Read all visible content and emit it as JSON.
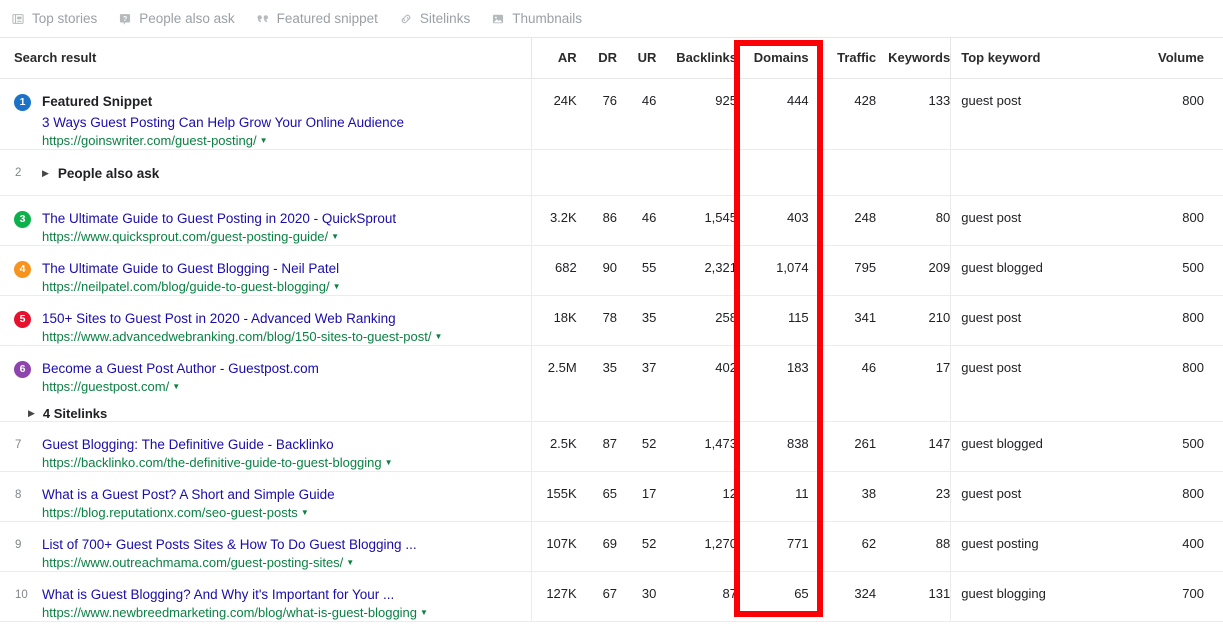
{
  "feature_bar": {
    "chips": [
      {
        "label": "Top stories",
        "icon": "news-article-icon"
      },
      {
        "label": "People also ask",
        "icon": "question-box-icon"
      },
      {
        "label": "Featured snippet",
        "icon": "quotation-marks-icon"
      },
      {
        "label": "Sitelinks",
        "icon": "link-chain-icon"
      },
      {
        "label": "Thumbnails",
        "icon": "image-thumbnail-icon"
      }
    ]
  },
  "table": {
    "headers": {
      "search_result": "Search result",
      "ar": "AR",
      "dr": "DR",
      "ur": "UR",
      "backlinks": "Backlinks",
      "domains": "Domains",
      "traffic": "Traffic",
      "keywords": "Keywords",
      "top_keyword": "Top keyword",
      "volume": "Volume"
    },
    "rows": [
      {
        "kind": "result",
        "rank": "1",
        "badge_color": "#1a73c8",
        "label": "Featured Snippet",
        "title": "3 Ways Guest Posting Can Help Grow Your Online Audience",
        "url": "https://goinswriter.com/guest-posting/",
        "ar": "24K",
        "dr": "76",
        "ur": "46",
        "backlinks": "925",
        "domains": "444",
        "traffic": "428",
        "keywords": "133",
        "top_keyword": "guest post",
        "volume": "800"
      },
      {
        "kind": "paa",
        "rank": "2",
        "label": "People also ask"
      },
      {
        "kind": "result",
        "rank": "3",
        "badge_color": "#0db14b",
        "title": "The Ultimate Guide to Guest Posting in 2020 - QuickSprout",
        "url": "https://www.quicksprout.com/guest-posting-guide/",
        "ar": "3.2K",
        "dr": "86",
        "ur": "46",
        "backlinks": "1,545",
        "domains": "403",
        "traffic": "248",
        "keywords": "80",
        "top_keyword": "guest post",
        "volume": "800"
      },
      {
        "kind": "result",
        "rank": "4",
        "badge_color": "#f7941e",
        "title": "The Ultimate Guide to Guest Blogging - Neil Patel",
        "url": "https://neilpatel.com/blog/guide-to-guest-blogging/",
        "ar": "682",
        "dr": "90",
        "ur": "55",
        "backlinks": "2,321",
        "domains": "1,074",
        "traffic": "795",
        "keywords": "209",
        "top_keyword": "guest blogged",
        "volume": "500"
      },
      {
        "kind": "result",
        "rank": "5",
        "badge_color": "#e8112d",
        "title": "150+ Sites to Guest Post in 2020 - Advanced Web Ranking",
        "url": "https://www.advancedwebranking.com/blog/150-sites-to-guest-post/",
        "ar": "18K",
        "dr": "78",
        "ur": "35",
        "backlinks": "258",
        "domains": "115",
        "traffic": "341",
        "keywords": "210",
        "top_keyword": "guest post",
        "volume": "800"
      },
      {
        "kind": "result",
        "rank": "6",
        "badge_color": "#8e44ad",
        "title": "Become a Guest Post Author - Guestpost.com",
        "url": "https://guestpost.com/",
        "sitelinks": "4 Sitelinks",
        "ar": "2.5M",
        "dr": "35",
        "ur": "37",
        "backlinks": "402",
        "domains": "183",
        "traffic": "46",
        "keywords": "17",
        "top_keyword": "guest post",
        "volume": "800"
      },
      {
        "kind": "result",
        "rank": "7",
        "badge_color": null,
        "title": "Guest Blogging: The Definitive Guide - Backlinko",
        "url": "https://backlinko.com/the-definitive-guide-to-guest-blogging",
        "ar": "2.5K",
        "dr": "87",
        "ur": "52",
        "backlinks": "1,473",
        "domains": "838",
        "traffic": "261",
        "keywords": "147",
        "top_keyword": "guest blogged",
        "volume": "500"
      },
      {
        "kind": "result",
        "rank": "8",
        "badge_color": null,
        "title": "What is a Guest Post? A Short and Simple Guide",
        "url": "https://blog.reputationx.com/seo-guest-posts",
        "ar": "155K",
        "dr": "65",
        "ur": "17",
        "backlinks": "12",
        "domains": "11",
        "traffic": "38",
        "keywords": "23",
        "top_keyword": "guest post",
        "volume": "800"
      },
      {
        "kind": "result",
        "rank": "9",
        "badge_color": null,
        "title": "List of 700+ Guest Posts Sites & How To Do Guest Blogging ...",
        "url": "https://www.outreachmama.com/guest-posting-sites/",
        "ar": "107K",
        "dr": "69",
        "ur": "52",
        "backlinks": "1,270",
        "domains": "771",
        "traffic": "62",
        "keywords": "88",
        "top_keyword": "guest posting",
        "volume": "400"
      },
      {
        "kind": "result",
        "rank": "10",
        "badge_color": null,
        "title": "What is Guest Blogging? And Why it's Important for Your ...",
        "url": "https://www.newbreedmarketing.com/blog/what-is-guest-blogging",
        "ar": "127K",
        "dr": "67",
        "ur": "30",
        "backlinks": "87",
        "domains": "65",
        "traffic": "324",
        "keywords": "131",
        "top_keyword": "guest blogging",
        "volume": "700"
      }
    ]
  },
  "annotation": {
    "highlight_color": "#fb0007",
    "highlighted_column": "Domains"
  }
}
